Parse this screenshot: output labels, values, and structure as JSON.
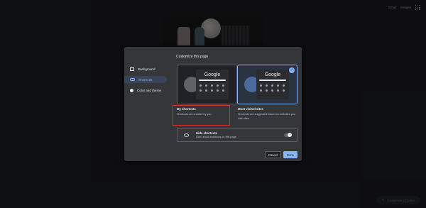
{
  "topbar": {
    "gmail_label": "Gmail",
    "images_label": "Images",
    "apps_icon": "apps-grid-icon"
  },
  "customize_chip": {
    "label": "Customize Chrome",
    "icon": "pencil-icon"
  },
  "dialog": {
    "title": "Customize this page",
    "sidebar": {
      "items": [
        {
          "label": "Background",
          "icon": "image-icon",
          "active": false
        },
        {
          "label": "Shortcuts",
          "icon": "link-icon",
          "active": true
        },
        {
          "label": "Color and theme",
          "icon": "palette-icon",
          "active": false
        }
      ]
    },
    "preview_logo": "Google",
    "options": {
      "my_shortcuts": {
        "title": "My shortcuts",
        "description": "Shortcuts are curated by you"
      },
      "most_visited": {
        "title": "Most visited sites",
        "description": "Shortcuts are suggested based on websites you visit often",
        "selected": true
      }
    },
    "hide_shortcuts": {
      "title": "Hide shortcuts",
      "description": "Don't show shortcuts on this page",
      "enabled": true
    },
    "buttons": {
      "cancel": "Cancel",
      "done": "Done"
    },
    "check_glyph": "✓"
  },
  "colors": {
    "accent": "#8ab4f8",
    "highlight": "#d93025",
    "surface": "#35363a",
    "page": "#202124"
  }
}
